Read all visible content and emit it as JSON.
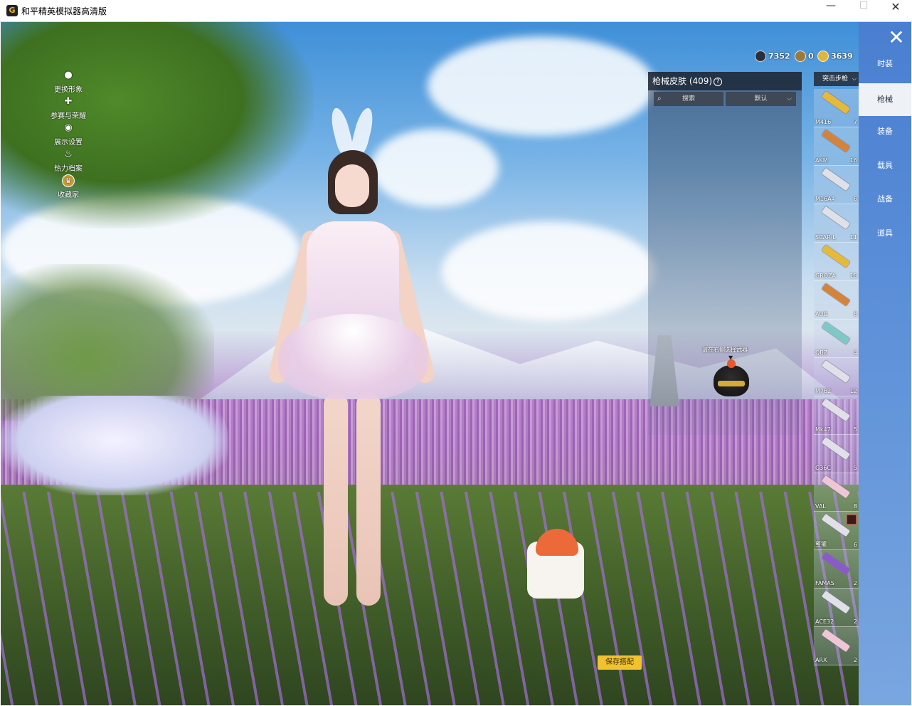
{
  "window": {
    "title": "和平精英模拟器高清版",
    "app_icon": "game-logo-icon",
    "controls": {
      "minimize": "—",
      "maximize": "☐",
      "close": "✕"
    }
  },
  "left_menu": [
    {
      "label": "更换形象",
      "icon": "person-icon"
    },
    {
      "label": "参赛与荣耀",
      "icon": "puzzle-icon"
    },
    {
      "label": "展示设置",
      "icon": "eye-icon"
    },
    {
      "label": "热力档案",
      "icon": "flame-icon"
    },
    {
      "label": "收藏家",
      "icon": "collector-badge-icon"
    }
  ],
  "currency": [
    {
      "value": "7352",
      "icon": "coin-dark-icon",
      "color": "#2b2f3a"
    },
    {
      "value": "0",
      "icon": "coin-bronze-icon",
      "color": "#9c7a3c"
    },
    {
      "value": "3639",
      "icon": "coin-gold-icon",
      "color": "#e2b63a"
    }
  ],
  "skin_panel": {
    "title": "枪械皮肤 (409)",
    "search_placeholder": "搜索",
    "sort_label": "默认",
    "empty_hint": "请在右侧选择武器"
  },
  "category_select": {
    "value": "突击步枪"
  },
  "weapons": [
    {
      "name": "M416",
      "count": "7",
      "color": "gold"
    },
    {
      "name": "AKM",
      "count": "16",
      "color": "orange"
    },
    {
      "name": "M16A4",
      "count": "6",
      "color": "silver"
    },
    {
      "name": "SCAR-L",
      "count": "11",
      "color": "silver"
    },
    {
      "name": "GROZA",
      "count": "15",
      "color": "gold"
    },
    {
      "name": "AUG",
      "count": "8",
      "color": "orange"
    },
    {
      "name": "QBZ",
      "count": "4",
      "color": "teal"
    },
    {
      "name": "M762",
      "count": "12",
      "color": "silver"
    },
    {
      "name": "Mk47",
      "count": "5",
      "color": "silver"
    },
    {
      "name": "G36C",
      "count": "5",
      "color": "silver"
    },
    {
      "name": "VAL",
      "count": "8",
      "color": "pink"
    },
    {
      "name": "蜜獾",
      "count": "6",
      "color": "silver",
      "badge": true
    },
    {
      "name": "FAMAS",
      "count": "2",
      "color": "purple"
    },
    {
      "name": "ACE32",
      "count": "2",
      "color": "silver"
    },
    {
      "name": "ARX",
      "count": "2",
      "color": "pink"
    }
  ],
  "tabs": [
    {
      "label": "时装",
      "active": false
    },
    {
      "label": "枪械",
      "active": true
    },
    {
      "label": "装备",
      "active": false
    },
    {
      "label": "载具",
      "active": false
    },
    {
      "label": "战备",
      "active": false
    },
    {
      "label": "道具",
      "active": false
    }
  ],
  "close_label": "✕",
  "save_button": "保存搭配"
}
